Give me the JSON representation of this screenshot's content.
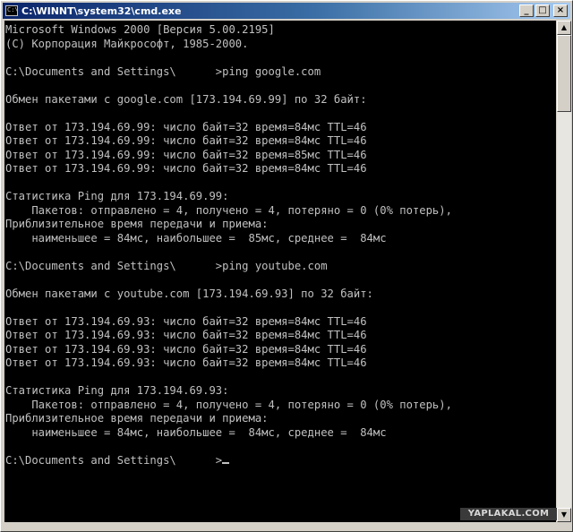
{
  "window": {
    "title": "C:\\WINNT\\system32\\cmd.exe",
    "icon_text": "C:\\",
    "buttons": {
      "minimize": "_",
      "maximize": "□",
      "close": "×"
    }
  },
  "console": {
    "lines": [
      "Microsoft Windows 2000 [Версия 5.00.2195]",
      "(C) Корпорация Майкрософт, 1985-2000.",
      "",
      "C:\\Documents and Settings\\      >ping google.com",
      "",
      "Обмен пакетами с google.com [173.194.69.99] по 32 байт:",
      "",
      "Ответ от 173.194.69.99: число байт=32 время=84мс TTL=46",
      "Ответ от 173.194.69.99: число байт=32 время=84мс TTL=46",
      "Ответ от 173.194.69.99: число байт=32 время=85мс TTL=46",
      "Ответ от 173.194.69.99: число байт=32 время=84мс TTL=46",
      "",
      "Статистика Ping для 173.194.69.99:",
      "    Пакетов: отправлено = 4, получено = 4, потеряно = 0 (0% потерь),",
      "Приблизительное время передачи и приема:",
      "    наименьшее = 84мс, наибольшее =  85мс, среднее =  84мс",
      "",
      "C:\\Documents and Settings\\      >ping youtube.com",
      "",
      "Обмен пакетами с youtube.com [173.194.69.93] по 32 байт:",
      "",
      "Ответ от 173.194.69.93: число байт=32 время=84мс TTL=46",
      "Ответ от 173.194.69.93: число байт=32 время=84мс TTL=46",
      "Ответ от 173.194.69.93: число байт=32 время=84мс TTL=46",
      "Ответ от 173.194.69.93: число байт=32 время=84мс TTL=46",
      "",
      "Статистика Ping для 173.194.69.93:",
      "    Пакетов: отправлено = 4, получено = 4, потеряно = 0 (0% потерь),",
      "Приблизительное время передачи и приема:",
      "    наименьшее = 84мс, наибольшее =  84мс, среднее =  84мс",
      "",
      "C:\\Documents and Settings\\      >"
    ],
    "text_color": "#c0c0c0",
    "background_color": "#000000"
  },
  "scrollbar": {
    "up_glyph": "▲",
    "down_glyph": "▼"
  },
  "watermark": {
    "text": "YAPLAKAL.COM"
  },
  "colors": {
    "titlebar_start": "#0a246a",
    "titlebar_end": "#a6caf0",
    "chrome": "#d4d0c8"
  }
}
